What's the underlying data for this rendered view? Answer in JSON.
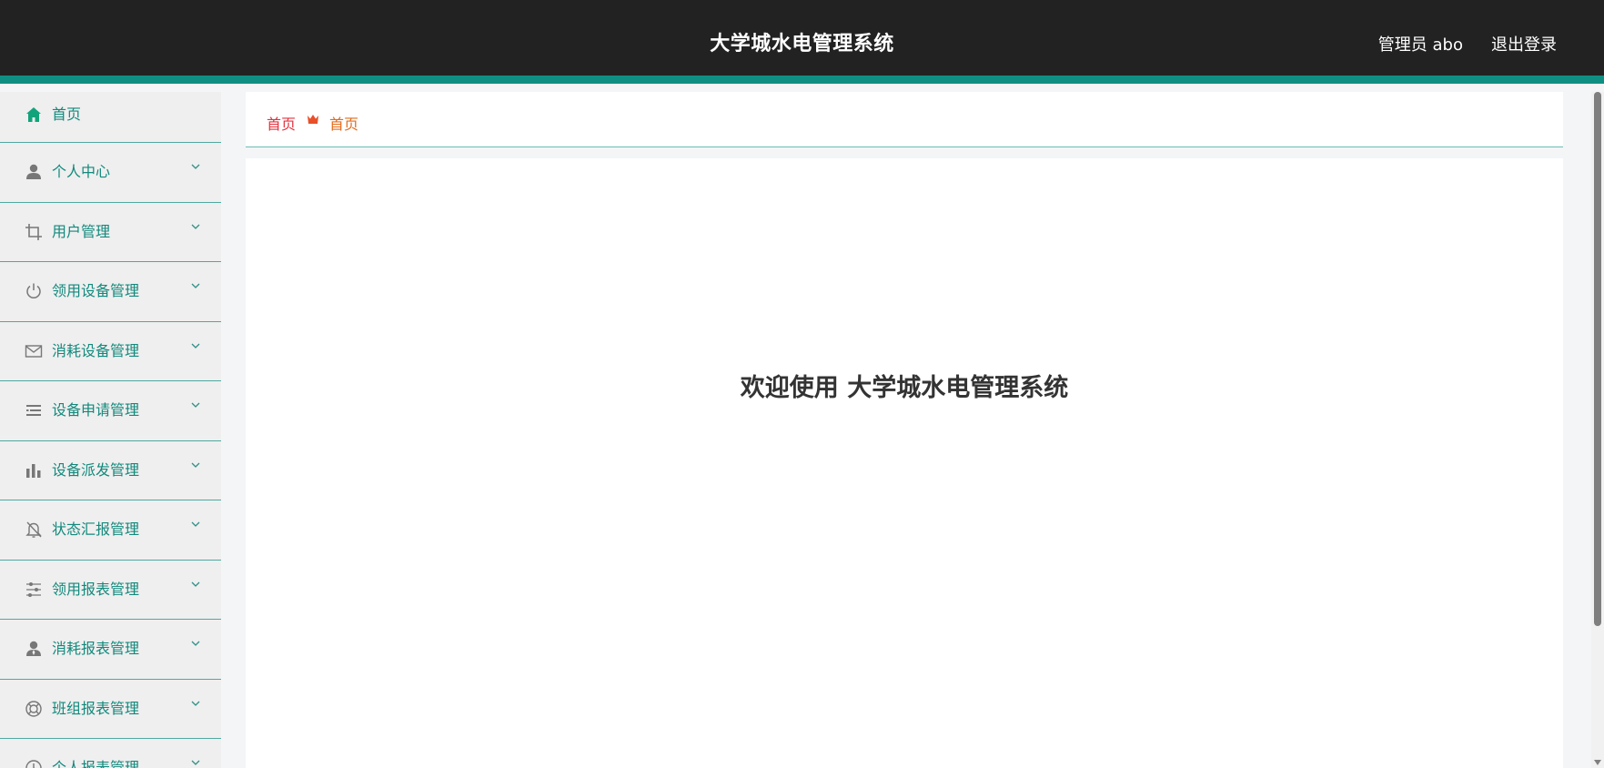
{
  "header": {
    "title": "大学城水电管理系统",
    "user": "管理员 abo",
    "logout": "退出登录"
  },
  "sidebar": {
    "items": [
      {
        "label": "首页",
        "icon": "home-icon"
      },
      {
        "label": "个人中心",
        "icon": "user-icon"
      },
      {
        "label": "用户管理",
        "icon": "crop-icon"
      },
      {
        "label": "领用设备管理",
        "icon": "power-icon"
      },
      {
        "label": "消耗设备管理",
        "icon": "mail-icon"
      },
      {
        "label": "设备申请管理",
        "icon": "list-icon"
      },
      {
        "label": "设备派发管理",
        "icon": "bar-chart-icon"
      },
      {
        "label": "状态汇报管理",
        "icon": "bell-off-icon"
      },
      {
        "label": "领用报表管理",
        "icon": "sliders-icon"
      },
      {
        "label": "消耗报表管理",
        "icon": "person-icon"
      },
      {
        "label": "班组报表管理",
        "icon": "lifebuoy-icon"
      },
      {
        "label": "个人报表管理",
        "icon": "clock-icon"
      }
    ]
  },
  "breadcrumb": {
    "first": "首页",
    "second": "首页"
  },
  "main": {
    "welcome": "欢迎使用 大学城水电管理系统"
  },
  "colors": {
    "header_bg": "#222222",
    "accent": "#0f8f83",
    "menu_text": "#12897c",
    "crumb_first": "#e2323e",
    "crumb_second": "#e26b1c"
  }
}
